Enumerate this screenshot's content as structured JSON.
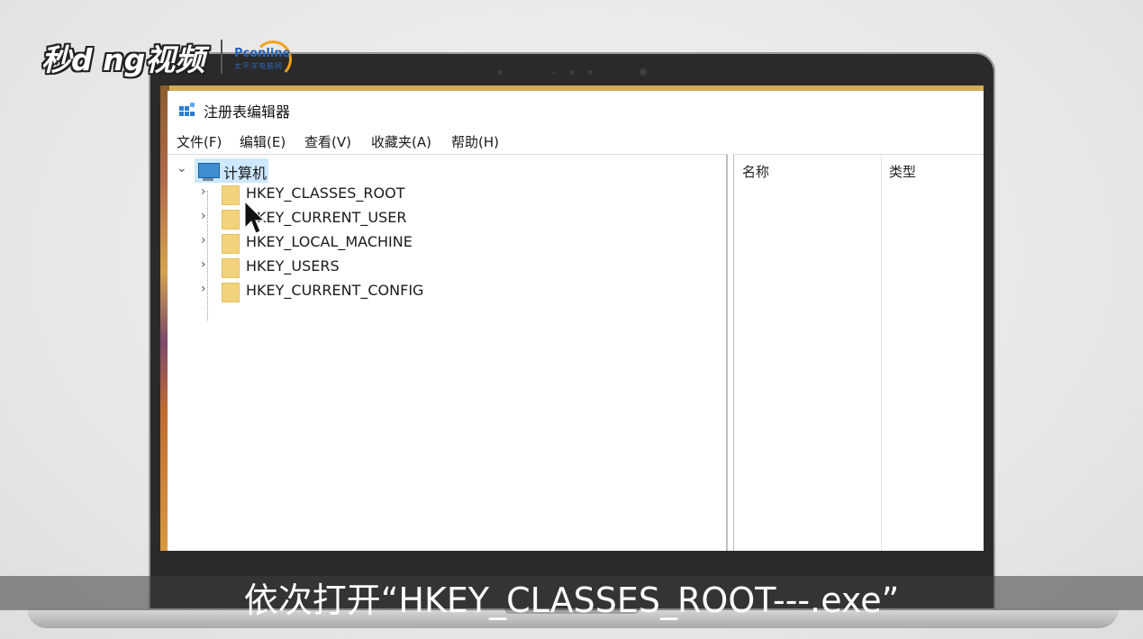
{
  "watermark": {
    "brand": "秒d ng视频",
    "partner_logo_text": "Pconline",
    "partner_logo_sub": "太平洋电脑网"
  },
  "window": {
    "title": "注册表编辑器",
    "app_icon": "regedit-icon"
  },
  "menu": [
    "文件(F)",
    "编辑(E)",
    "查看(V)",
    "收藏夹(A)",
    "帮助(H)"
  ],
  "tree": {
    "root": {
      "label": "计算机",
      "icon": "computer-icon",
      "expanded": true,
      "selected": true
    },
    "children": [
      {
        "label": "HKEY_CLASSES_ROOT",
        "icon": "folder-icon"
      },
      {
        "label": "HKEY_CURRENT_USER",
        "icon": "folder-icon"
      },
      {
        "label": "HKEY_LOCAL_MACHINE",
        "icon": "folder-icon"
      },
      {
        "label": "HKEY_USERS",
        "icon": "folder-icon"
      },
      {
        "label": "HKEY_CURRENT_CONFIG",
        "icon": "folder-icon"
      }
    ]
  },
  "list_columns": [
    "名称",
    "类型"
  ],
  "subtitle": "依次打开“HKEY_CLASSES_ROOT---.exe”",
  "colors": {
    "selection": "#cde8ff",
    "folder": "#f2d27a",
    "subtitle_bar": "#3c3c3c"
  }
}
